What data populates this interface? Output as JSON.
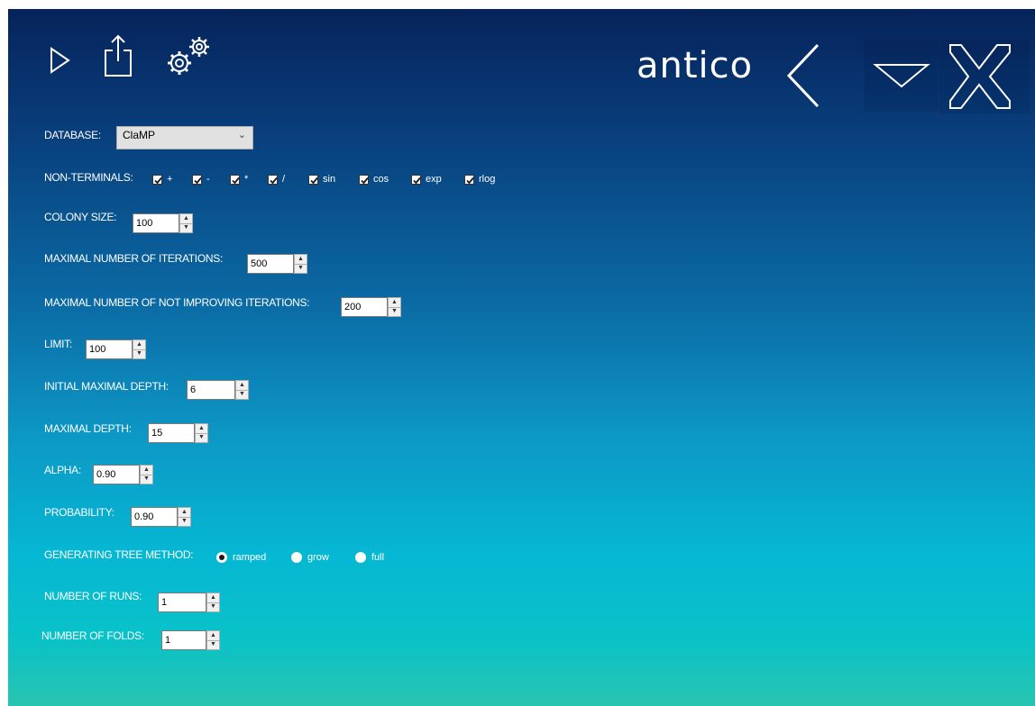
{
  "toolbar": {
    "icons": [
      "play-icon",
      "export-icon",
      "settings-icon"
    ]
  },
  "brand": {
    "name": "antico"
  },
  "window": {
    "icons": [
      "back-icon",
      "minimize-icon",
      "close-icon"
    ]
  },
  "form": {
    "database": {
      "label": "DATABASE:",
      "value": "ClaMP"
    },
    "non_terminals": {
      "label": "NON-TERMINALS:",
      "options": [
        {
          "label": "+",
          "checked": true
        },
        {
          "label": "-",
          "checked": true
        },
        {
          "label": "*",
          "checked": true
        },
        {
          "label": "/",
          "checked": true
        },
        {
          "label": "sin",
          "checked": true
        },
        {
          "label": "cos",
          "checked": true
        },
        {
          "label": "exp",
          "checked": true
        },
        {
          "label": "rlog",
          "checked": true
        }
      ]
    },
    "colony_size": {
      "label": "COLONY SIZE:",
      "value": "100"
    },
    "max_iterations": {
      "label": "MAXIMAL NUMBER OF ITERATIONS:",
      "value": "500"
    },
    "max_not_improving": {
      "label": "MAXIMAL NUMBER OF NOT IMPROVING ITERATIONS:",
      "value": "200"
    },
    "limit": {
      "label": "LIMIT:",
      "value": "100"
    },
    "initial_max_depth": {
      "label": "INITIAL MAXIMAL DEPTH:",
      "value": "6"
    },
    "max_depth": {
      "label": "MAXIMAL DEPTH:",
      "value": "15"
    },
    "alpha": {
      "label": "ALPHA:",
      "value": "0.90"
    },
    "probability": {
      "label": "PROBABILITY:",
      "value": "0.90"
    },
    "tree_method": {
      "label": "GENERATING TREE METHOD:",
      "options": [
        {
          "label": "ramped",
          "selected": true
        },
        {
          "label": "grow",
          "selected": false
        },
        {
          "label": "full",
          "selected": false
        }
      ]
    },
    "runs": {
      "label": "NUMBER OF RUNS:",
      "value": "1"
    },
    "folds": {
      "label": "NUMBER OF FOLDS:",
      "value": "1"
    }
  }
}
